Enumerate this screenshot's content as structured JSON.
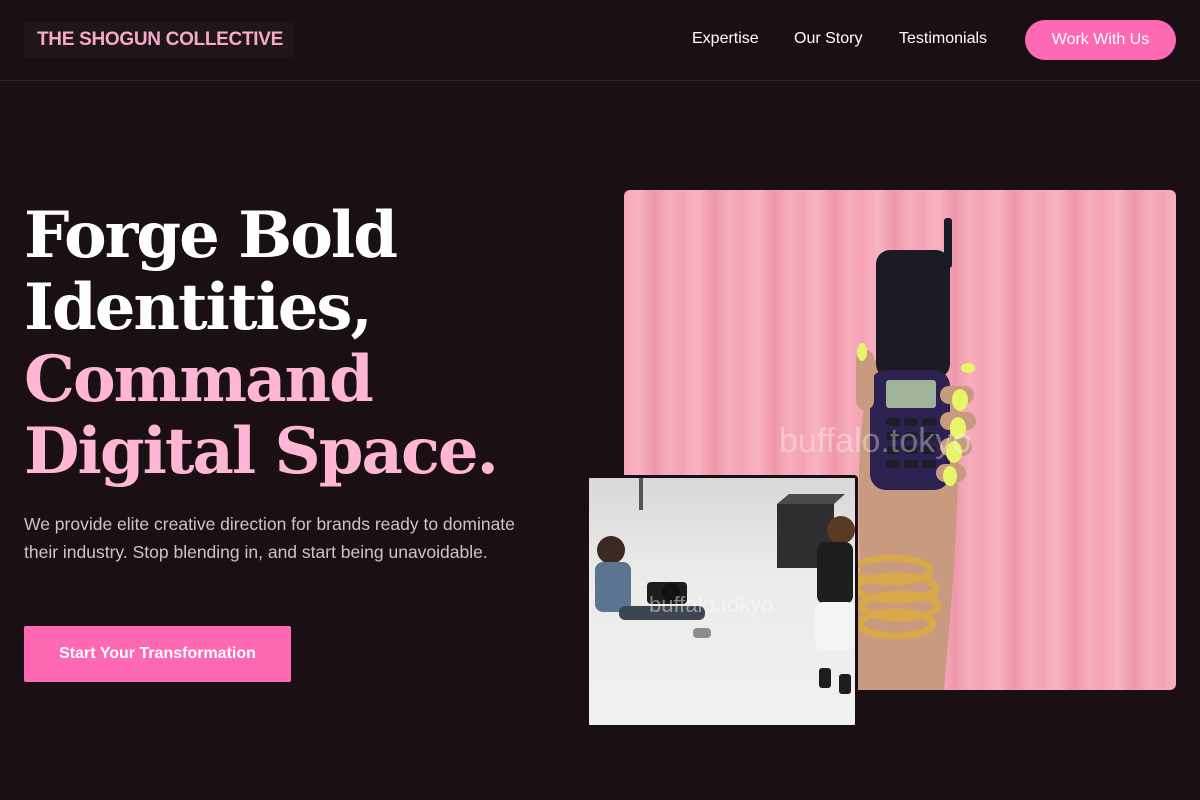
{
  "header": {
    "logo": "THE SHOGUN COLLECTIVE",
    "nav": [
      "Expertise",
      "Our Story",
      "Testimonials"
    ],
    "cta": "Work With Us"
  },
  "hero": {
    "headline_lines": [
      "Forge Bold",
      "Identities,",
      "Command",
      "Digital Space."
    ],
    "subtext": "We provide elite creative direction for brands ready to dominate their industry. Stop blending in, and start being unavoidable.",
    "cta": "Start Your Transformation"
  },
  "images": {
    "main_watermark": "buffalo.tokyo",
    "secondary_watermark": "buffalo.tokyo"
  },
  "colors": {
    "background": "#1a1013",
    "accent": "#ff69b4",
    "accent_light": "#ffb6d4",
    "logo": "#f7a8c8"
  }
}
